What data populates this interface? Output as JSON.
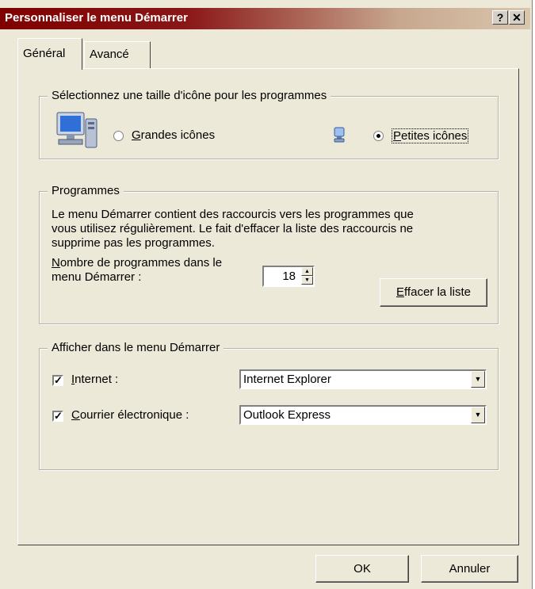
{
  "window": {
    "title": "Personnaliser le menu Démarrer",
    "help_button": "?",
    "close_button": "✕"
  },
  "tabs": [
    {
      "label": "Général",
      "active": true
    },
    {
      "label": "Avancé",
      "active": false
    }
  ],
  "icon_size": {
    "legend": "Sélectionnez une taille d'icône pour les programmes",
    "large_label_accel": "G",
    "large_label_rest": "randes icônes",
    "small_label_accel": "P",
    "small_label_rest": "etites icônes",
    "selected": "small"
  },
  "programs": {
    "legend": "Programmes",
    "description_line1": "Le menu Démarrer contient des raccourcis vers les programmes que",
    "description_line2": "vous utilisez régulièrement. Le fait d'effacer la liste des raccourcis ne",
    "description_line3": "supprime pas les programmes.",
    "count_label_accel": "N",
    "count_label_line1_rest": "ombre de programmes dans le",
    "count_label_line2": "menu Démarrer :",
    "count_value": "18",
    "clear_button_accel": "E",
    "clear_button_rest": "ffacer la liste"
  },
  "show_in_menu": {
    "legend": "Afficher dans le menu Démarrer",
    "internet_label_accel": "I",
    "internet_label_rest": "nternet :",
    "internet_checked": true,
    "internet_value": "Internet Explorer",
    "email_label_accel": "C",
    "email_label_rest": "ourrier électronique :",
    "email_checked": true,
    "email_value": "Outlook Express"
  },
  "footer": {
    "ok_label": "OK",
    "cancel_label": "Annuler"
  },
  "colors": {
    "titlebar_start": "#800000",
    "face": "#ece9d8"
  }
}
